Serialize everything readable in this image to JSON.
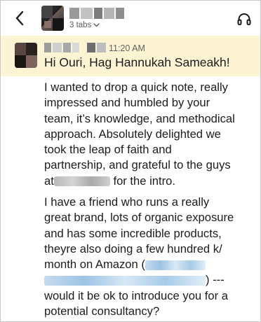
{
  "header": {
    "tabs_label": "3 tabs",
    "icons": {
      "back": "chevron-left-icon",
      "tabs_chevron": "chevron-down-icon",
      "huddle": "headphones-icon"
    }
  },
  "message": {
    "timestamp": "11:20 AM",
    "greeting": "Hi Ouri, Hag Hannukah Sameakh!",
    "p1": {
      "l1": "I wanted to drop a quick note, really",
      "l2": "impressed and humbled by your",
      "l3": "team, it’s knowledge, and methodical",
      "l4": "approach. Absolutely delighted we",
      "l5": "took the leap of faith and",
      "l6": "partnership, and grateful to the guys",
      "l7a": "at",
      "l7b": " for the intro."
    },
    "p2": {
      "l1": "I have a friend who runs a really",
      "l2": "great brand, lots of organic exposure",
      "l3": "and has some incredible products,",
      "l4": "theyre also doing a few hundred k/",
      "l5": "month on Amazon  (",
      "l6": ") ---",
      "l7": "would it be ok to introduce you for a",
      "l8": "potential consultancy?"
    }
  },
  "colors": {
    "highlight": "#fdf4d3",
    "text": "#1d1c1d",
    "muted": "#616061"
  }
}
